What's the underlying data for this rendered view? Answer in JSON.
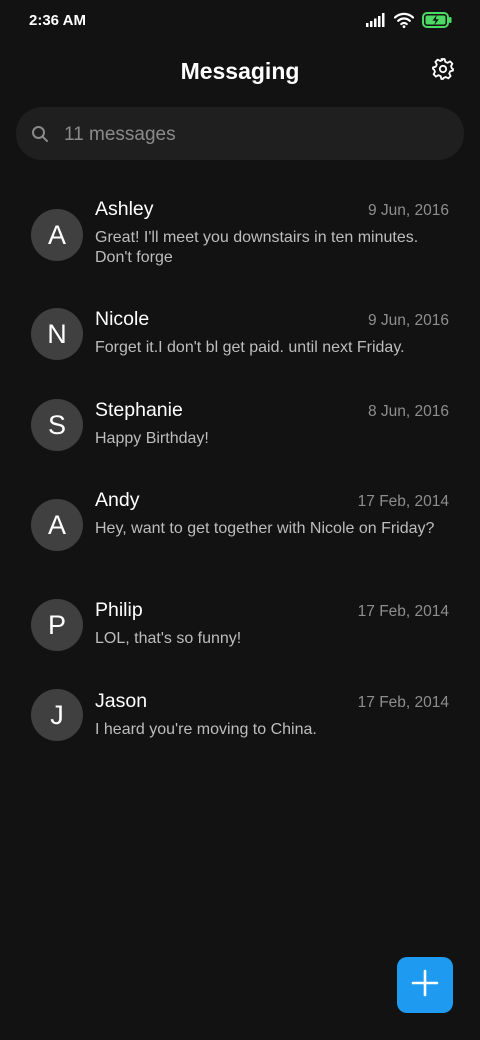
{
  "status_bar": {
    "time": "2:36 AM",
    "icons": [
      "signal-icon",
      "wifi-icon",
      "battery-charging-icon"
    ]
  },
  "header": {
    "title": "Messaging",
    "settings_icon": "gear-icon"
  },
  "search": {
    "placeholder": "11 messages",
    "icon": "search-icon"
  },
  "conversations": [
    {
      "initial": "A",
      "name": "Ashley",
      "date": "9 Jun, 2016",
      "preview": "Great! I'll meet you downstairs in ten minutes. Don't forge"
    },
    {
      "initial": "N",
      "name": "Nicole",
      "date": "9 Jun, 2016",
      "preview": "Forget it.I don't bl get paid. until next Friday."
    },
    {
      "initial": "S",
      "name": "Stephanie",
      "date": "8 Jun, 2016",
      "preview": "Happy Birthday!"
    },
    {
      "initial": "A",
      "name": "Andy",
      "date": "17 Feb, 2014",
      "preview": "Hey, want to get together with Nicole on Friday?"
    },
    {
      "initial": "P",
      "name": "Philip",
      "date": "17 Feb, 2014",
      "preview": "LOL, that's so funny!"
    },
    {
      "initial": "J",
      "name": "Jason",
      "date": "17 Feb, 2014",
      "preview": "I heard you're moving to China."
    }
  ],
  "fab": {
    "icon": "plus-icon"
  },
  "colors": {
    "background": "#121212",
    "search_background": "#1f1f1f",
    "avatar_background": "#404040",
    "accent": "#1e9bf0",
    "battery": "#4cd964"
  }
}
